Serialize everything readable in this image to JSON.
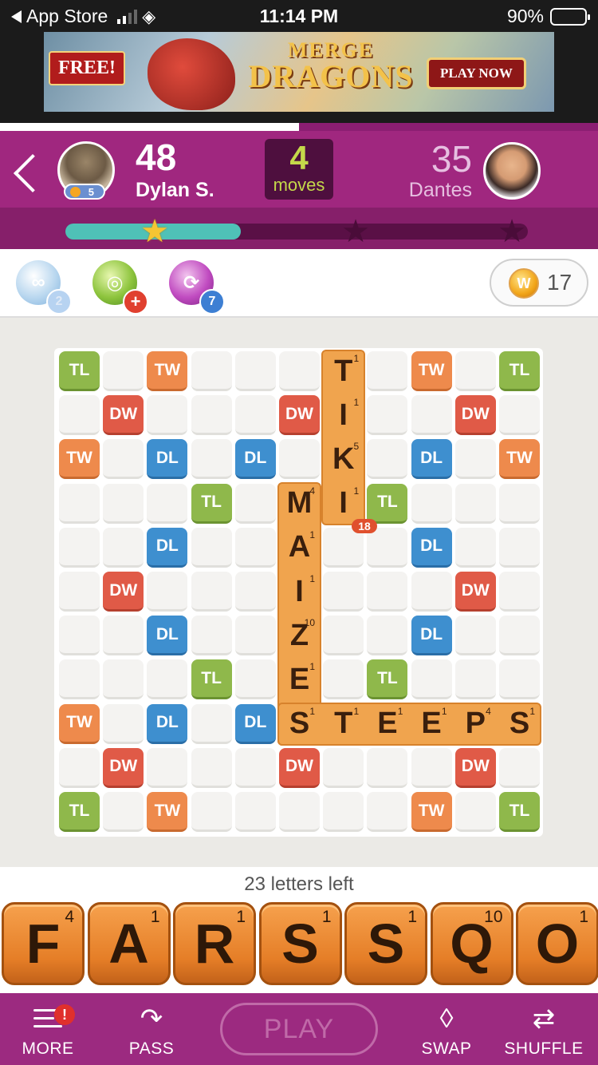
{
  "status_bar": {
    "back_app": "App Store",
    "time": "11:14 PM",
    "battery": "90%"
  },
  "ad": {
    "free": "FREE!",
    "title_line1": "MERGE",
    "title_line2": "DRAGONS",
    "cta": "PLAY NOW"
  },
  "header": {
    "player": {
      "score": "48",
      "name": "Dylan S.",
      "level": "5"
    },
    "moves": {
      "count": "4",
      "label": "moves"
    },
    "opponent": {
      "score": "35",
      "name": "Dantes"
    },
    "star_progress": 0.38
  },
  "powerups": [
    {
      "name": "hindsight",
      "count": "2"
    },
    {
      "name": "word-radar",
      "count": "+"
    },
    {
      "name": "swap-plus",
      "count": "7"
    }
  ],
  "coins": {
    "symbol": "W",
    "count": "17"
  },
  "board": {
    "premium_squares": [
      [
        0,
        0,
        "TL"
      ],
      [
        0,
        2,
        "TW"
      ],
      [
        0,
        8,
        "TW"
      ],
      [
        0,
        10,
        "TL"
      ],
      [
        1,
        1,
        "DW"
      ],
      [
        1,
        5,
        "DW"
      ],
      [
        1,
        9,
        "DW"
      ],
      [
        2,
        0,
        "TW"
      ],
      [
        2,
        2,
        "DL"
      ],
      [
        2,
        4,
        "DL"
      ],
      [
        2,
        8,
        "DL"
      ],
      [
        2,
        10,
        "TW"
      ],
      [
        3,
        3,
        "TL"
      ],
      [
        3,
        7,
        "TL"
      ],
      [
        4,
        2,
        "DL"
      ],
      [
        4,
        8,
        "DL"
      ],
      [
        5,
        1,
        "DW"
      ],
      [
        5,
        9,
        "DW"
      ],
      [
        6,
        2,
        "DL"
      ],
      [
        6,
        8,
        "DL"
      ],
      [
        7,
        3,
        "TL"
      ],
      [
        7,
        7,
        "TL"
      ],
      [
        8,
        0,
        "TW"
      ],
      [
        8,
        2,
        "DL"
      ],
      [
        8,
        4,
        "DL"
      ],
      [
        8,
        8,
        "DL"
      ],
      [
        8,
        10,
        "TW"
      ],
      [
        9,
        1,
        "DW"
      ],
      [
        9,
        5,
        "DW"
      ],
      [
        9,
        9,
        "DW"
      ],
      [
        10,
        0,
        "TL"
      ],
      [
        10,
        2,
        "TW"
      ],
      [
        10,
        8,
        "TW"
      ],
      [
        10,
        10,
        "TL"
      ]
    ],
    "tiles": [
      {
        "row": 0,
        "col": 6,
        "letter": "T",
        "points": "1"
      },
      {
        "row": 1,
        "col": 6,
        "letter": "I",
        "points": "1"
      },
      {
        "row": 2,
        "col": 6,
        "letter": "K",
        "points": "5"
      },
      {
        "row": 3,
        "col": 6,
        "letter": "I",
        "points": "1"
      },
      {
        "row": 3,
        "col": 5,
        "letter": "M",
        "points": "4"
      },
      {
        "row": 4,
        "col": 5,
        "letter": "A",
        "points": "1"
      },
      {
        "row": 5,
        "col": 5,
        "letter": "I",
        "points": "1"
      },
      {
        "row": 6,
        "col": 5,
        "letter": "Z",
        "points": "10"
      },
      {
        "row": 7,
        "col": 5,
        "letter": "E",
        "points": "1"
      },
      {
        "row": 8,
        "col": 5,
        "letter": "S",
        "points": "1"
      },
      {
        "row": 8,
        "col": 6,
        "letter": "T",
        "points": "1"
      },
      {
        "row": 8,
        "col": 7,
        "letter": "E",
        "points": "1"
      },
      {
        "row": 8,
        "col": 8,
        "letter": "E",
        "points": "1"
      },
      {
        "row": 8,
        "col": 9,
        "letter": "P",
        "points": "4"
      },
      {
        "row": 8,
        "col": 10,
        "letter": "S",
        "points": "1"
      }
    ],
    "last_word_score": "18"
  },
  "rack": {
    "letters_left": "23 letters left",
    "tiles": [
      {
        "letter": "F",
        "points": "4"
      },
      {
        "letter": "A",
        "points": "1"
      },
      {
        "letter": "R",
        "points": "1"
      },
      {
        "letter": "S",
        "points": "1"
      },
      {
        "letter": "S",
        "points": "1"
      },
      {
        "letter": "Q",
        "points": "10"
      },
      {
        "letter": "O",
        "points": "1"
      }
    ]
  },
  "bottom_bar": {
    "more": "MORE",
    "more_badge": "!",
    "pass": "PASS",
    "play": "PLAY",
    "swap": "SWAP",
    "shuffle": "SHUFFLE"
  },
  "colors": {
    "header": "#a0277f",
    "TL": "#8fb84b",
    "TW": "#ee8a4c",
    "DL": "#3e8fcf",
    "DW": "#e05a47",
    "tile": "#f0a44e",
    "moves_text": "#c4d84a"
  }
}
